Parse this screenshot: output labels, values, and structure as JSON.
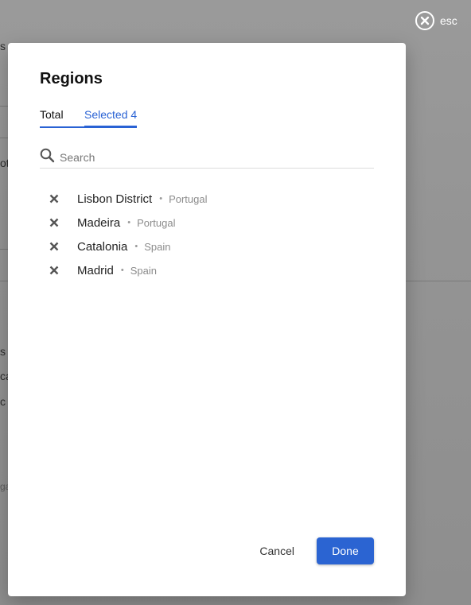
{
  "close": {
    "label": "esc",
    "icon": "close-circle-icon"
  },
  "background_fragments": [
    "s",
    "ot",
    "s",
    "ca",
    "c",
    "ga"
  ],
  "modal": {
    "title": "Regions",
    "tabs": [
      {
        "label": "Total",
        "active": false
      },
      {
        "label": "Selected 4",
        "active": true
      }
    ],
    "search": {
      "placeholder": "Search",
      "value": ""
    },
    "items": [
      {
        "name": "Lisbon District",
        "country": "Portugal"
      },
      {
        "name": "Madeira",
        "country": "Portugal"
      },
      {
        "name": "Catalonia",
        "country": "Spain"
      },
      {
        "name": "Madrid",
        "country": "Spain"
      }
    ],
    "separator": "•",
    "cancel_label": "Cancel",
    "done_label": "Done"
  },
  "colors": {
    "accent": "#2962d4",
    "button": "#2b64d2"
  }
}
